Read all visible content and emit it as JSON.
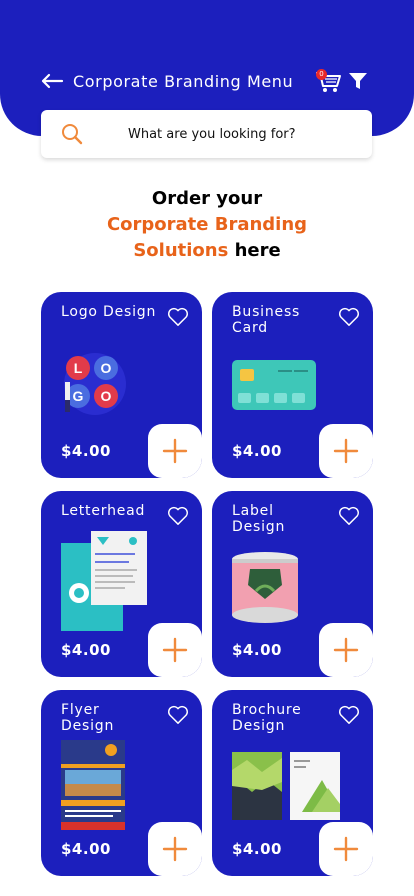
{
  "header": {
    "title": "Corporate Branding Menu",
    "cart_count": "0",
    "back_icon": "arrow-left-icon",
    "cart_icon": "cart-icon",
    "filter_icon": "filter-icon"
  },
  "search": {
    "placeholder": "What are you looking for?",
    "icon": "search-icon"
  },
  "headline": {
    "line1": "Order your",
    "highlight_1": "Corporate Branding",
    "highlight_2": "Solutions",
    "line3_end": "here"
  },
  "colors": {
    "primary": "#1c1fbd",
    "accent": "#e8631a",
    "white": "#ffffff"
  },
  "products": [
    {
      "name": "Logo Design",
      "price": "$4.00",
      "image_icon": "logo-design-illustration"
    },
    {
      "name": "Business Card",
      "price": "$4.00",
      "image_icon": "business-card-illustration"
    },
    {
      "name": "Letterhead",
      "price": "$4.00",
      "image_icon": "letterhead-illustration"
    },
    {
      "name": "Label Design",
      "price": "$4.00",
      "image_icon": "label-can-illustration"
    },
    {
      "name": "Flyer Design",
      "price": "$4.00",
      "image_icon": "flyer-illustration"
    },
    {
      "name": "Brochure Design",
      "price": "$4.00",
      "image_icon": "brochure-illustration"
    }
  ]
}
